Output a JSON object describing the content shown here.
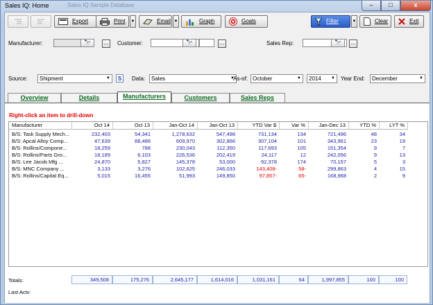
{
  "window": {
    "title": "Sales IQ: Home",
    "subtitle": "Sales IQ Sample Database",
    "minimize": "–",
    "restore": "□",
    "close": "x"
  },
  "toolbar": {
    "export": "Export",
    "print": "Print",
    "email": "Email",
    "graph": "Graph",
    "goals": "Goals",
    "filter": "Filter",
    "clear": "Clear",
    "exit": "Exit"
  },
  "filters": {
    "manufacturer_label": "Manufacturer:",
    "manufacturer_value": "",
    "customer_label": "Customer:",
    "customer_value": "",
    "salesrep_label": "Sales Rep:",
    "salesrep_value": "",
    "source_label": "Source:",
    "source_value": "Shipment",
    "s_badge": "S",
    "data_label": "Data:",
    "data_value": "Sales",
    "asof_label": "As-of:",
    "asof_month": "October",
    "asof_year": "2014",
    "yearend_label": "Year End:",
    "yearend_value": "December",
    "browse": "..."
  },
  "tabs": [
    {
      "label": "Overview"
    },
    {
      "label": "Details"
    },
    {
      "label": "Manufacturers"
    },
    {
      "label": "Customers"
    },
    {
      "label": "Sales Reps"
    }
  ],
  "hint": "Right-click an item to drill-down",
  "table": {
    "columns": [
      "Manufacturer",
      "Oct 14",
      "Oct 13",
      "Jan-Oct 14",
      "Jan-Oct 13",
      "YTD Var $",
      "Var %",
      "Jan-Dec 13",
      "YTD %",
      "LYT %"
    ],
    "rows": [
      {
        "cells": [
          "B/S: Task Supply Mech...",
          "232,403",
          "54,341",
          "1,278,632",
          "547,498",
          "731,134",
          "134",
          "721,496",
          "48",
          "34"
        ],
        "neg": false
      },
      {
        "cells": [
          "B/S: Apcal Alloy Comp...",
          "47,639",
          "88,486",
          "609,970",
          "302,866",
          "307,104",
          "101",
          "343,961",
          "23",
          "19"
        ],
        "neg": false
      },
      {
        "cells": [
          "B/S: Rollins/Compone...",
          "18,259",
          "788",
          "230,043",
          "112,350",
          "117,693",
          "105",
          "151,354",
          "9",
          "7"
        ],
        "neg": false
      },
      {
        "cells": [
          "B/S: Rollins/Parts Gro...",
          "18,189",
          "6,103",
          "226,536",
          "202,419",
          "24,117",
          "12",
          "242,056",
          "9",
          "13"
        ],
        "neg": false
      },
      {
        "cells": [
          "B/S: Lee Jacob Mfg     ...",
          "24,870",
          "5,827",
          "145,378",
          "53,000",
          "92,378",
          "174",
          "70,157",
          "5",
          "3"
        ],
        "neg": false
      },
      {
        "cells": [
          "B/S: MNC Company     ...",
          "3,133",
          "3,276",
          "102,625",
          "246,033",
          "143,408-",
          "58-",
          "299,863",
          "4",
          "15"
        ],
        "neg": true
      },
      {
        "cells": [
          "B/S: Rollins/Capital Eq...",
          "5,015",
          "16,455",
          "51,993",
          "149,850",
          "97,857-",
          "65-",
          "168,968",
          "2",
          "9"
        ],
        "neg": true
      }
    ]
  },
  "totals": {
    "label": "Totals:",
    "values": [
      "349,508",
      "175,276",
      "2,645,177",
      "1,614,016",
      "1,031,161",
      "64",
      "1,997,855",
      "100",
      "100"
    ]
  },
  "last_actv": "Last Actv:"
}
